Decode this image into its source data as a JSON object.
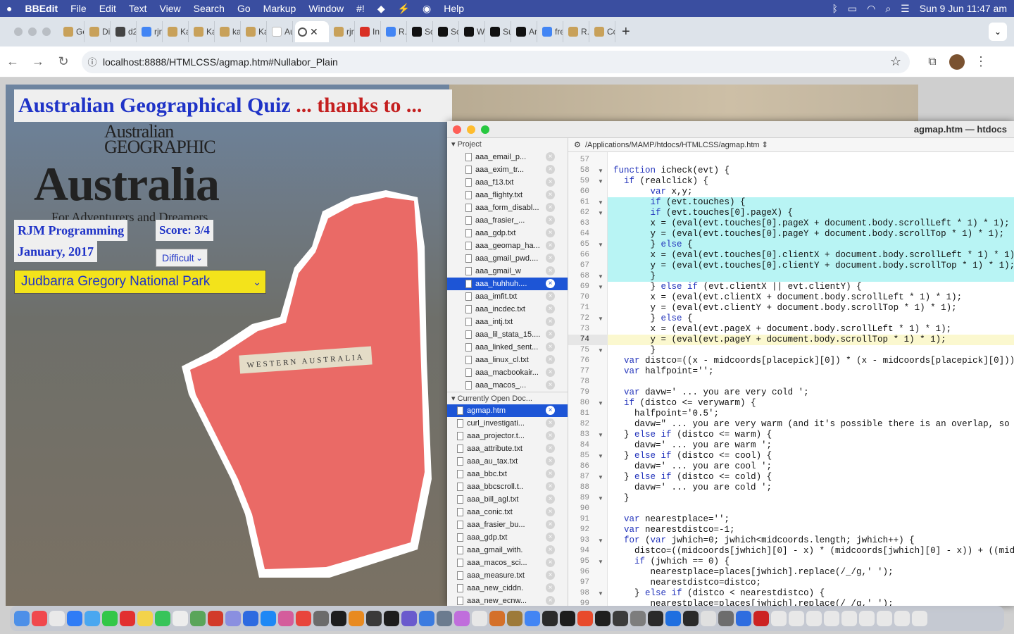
{
  "menubar": {
    "apple": "",
    "app_name": "BBEdit",
    "items": [
      "File",
      "Edit",
      "Text",
      "View",
      "Search",
      "Go",
      "Markup",
      "Window",
      "#!",
      "Help"
    ],
    "clock": "Sun 9 Jun  11:47 am"
  },
  "tabs": [
    {
      "label": "Ge",
      "icon": "#c8a15a"
    },
    {
      "label": "Di",
      "icon": "#c8a15a"
    },
    {
      "label": "d2",
      "icon": "#444444"
    },
    {
      "label": "rjn",
      "icon": "#4285f4"
    },
    {
      "label": "Ka",
      "icon": "#c8a15a"
    },
    {
      "label": "Ka",
      "icon": "#c8a15a"
    },
    {
      "label": "ka",
      "icon": "#c8a15a"
    },
    {
      "label": "Ka",
      "icon": "#c8a15a"
    },
    {
      "label": "Au",
      "icon": "#ffffff"
    },
    {
      "label": "rjn",
      "icon": "#c8a15a"
    },
    {
      "label": "In",
      "icon": "#d93025"
    },
    {
      "label": "R.",
      "icon": "#4285f4"
    },
    {
      "label": "Sc",
      "icon": "#111111"
    },
    {
      "label": "Sc",
      "icon": "#111111"
    },
    {
      "label": "W",
      "icon": "#111111"
    },
    {
      "label": "Su",
      "icon": "#111111"
    },
    {
      "label": "Ar",
      "icon": "#111111"
    },
    {
      "label": "fre",
      "icon": "#4285f4"
    },
    {
      "label": "R.",
      "icon": "#c8a15a"
    },
    {
      "label": "Cc",
      "icon": "#c8a15a"
    }
  ],
  "active_tab_close": "✕",
  "new_tab": "+",
  "address_bar": {
    "url": "localhost:8888/HTMLCSS/agmap.htm#Nullabor_Plain"
  },
  "quiz": {
    "title_main": "Australian Geographical Quiz",
    "title_thanks": " ... thanks to ...",
    "author": "RJM Programming",
    "date": "January, 2017",
    "score": "Score: 3/4",
    "difficulty": "Difficult",
    "selected_place": "Judbarra Gregory National Park",
    "region_label": "WESTERN AUSTRALIA",
    "cover_brand": "Australian GEOGRAPHIC",
    "cover_title": "Australia",
    "cover_tagline": "For Adventurers and Dreamers",
    "region_color": "#ea6a66"
  },
  "bbedit": {
    "window_title": "agmap.htm — htdocs",
    "path": "/Applications/MAMP/htdocs/HTMLCSS/agmap.htm",
    "project_header": "Project",
    "project_files": [
      "aaa_email_p...",
      "aaa_exim_tr...",
      "aaa_f13.txt",
      "aaa_flighty.txt",
      "aaa_form_disabl...",
      "aaa_frasier_...",
      "aaa_gdp.txt",
      "aaa_geomap_ha...",
      "aaa_gmail_pwd....",
      "aaa_gmail_w",
      "aaa_huhhuh....",
      "aaa_imfit.txt",
      "aaa_incdec.txt",
      "aaa_intj.txt",
      "aaa_lil_stata_15....",
      "aaa_linked_sent...",
      "aaa_linux_cl.txt",
      "aaa_macbookair...",
      "aaa_macos_..."
    ],
    "open_header": "Currently Open Doc...",
    "open_files": [
      "agmap.htm",
      "curl_investigati...",
      "aaa_projector.t...",
      "aaa_attribute.txt",
      "aaa_au_tax.txt",
      "aaa_bbc.txt",
      "aaa_bbcscroll.t..",
      "aaa_bill_agl.txt",
      "aaa_conic.txt",
      "aaa_frasier_bu...",
      "aaa_gdp.txt",
      "aaa_gmail_with.",
      "aaa_macos_sci...",
      "aaa_measure.txt",
      "aaa_new_ciddn.",
      "aaa_new_ecnw..."
    ],
    "current_line": "74",
    "code": [
      {
        "n": "57",
        "t": ""
      },
      {
        "n": "58",
        "t": "function icheck(evt) {"
      },
      {
        "n": "59",
        "t": "  if (realclick) {"
      },
      {
        "n": "60",
        "t": "       var x,y;"
      },
      {
        "n": "61",
        "t": "       if (evt.touches) {"
      },
      {
        "n": "62",
        "t": "       if (evt.touches[0].pageX) {"
      },
      {
        "n": "63",
        "t": "       x = (eval(evt.touches[0].pageX + document.body.scrollLeft * 1) * 1);"
      },
      {
        "n": "64",
        "t": "       y = (eval(evt.touches[0].pageY + document.body.scrollTop * 1) * 1);"
      },
      {
        "n": "65",
        "t": "       } else {"
      },
      {
        "n": "66",
        "t": "       x = (eval(evt.touches[0].clientX + document.body.scrollLeft * 1) * 1);"
      },
      {
        "n": "67",
        "t": "       y = (eval(evt.touches[0].clientY + document.body.scrollTop * 1) * 1);"
      },
      {
        "n": "68",
        "t": "       }"
      },
      {
        "n": "69",
        "t": "       } else if (evt.clientX || evt.clientY) {"
      },
      {
        "n": "70",
        "t": "       x = (eval(evt.clientX + document.body.scrollLeft * 1) * 1);"
      },
      {
        "n": "71",
        "t": "       y = (eval(evt.clientY + document.body.scrollTop * 1) * 1);"
      },
      {
        "n": "72",
        "t": "       } else {"
      },
      {
        "n": "73",
        "t": "       x = (eval(evt.pageX + document.body.scrollLeft * 1) * 1);"
      },
      {
        "n": "74",
        "t": "       y = (eval(evt.pageY + document.body.scrollTop * 1) * 1);"
      },
      {
        "n": "75",
        "t": "       }"
      },
      {
        "n": "76",
        "t": "  var distco=((x - midcoords[placepick][0]) * (x - midcoords[placepick][0])) +"
      },
      {
        "n": "77",
        "t": "  var halfpoint='';"
      },
      {
        "n": "78",
        "t": ""
      },
      {
        "n": "79",
        "t": "  var davw=' ... you are very cold ';"
      },
      {
        "n": "80",
        "t": "  if (distco <= verywarm) {"
      },
      {
        "n": "81",
        "t": "    halfpoint='0.5';"
      },
      {
        "n": "82",
        "t": "    davw=\" ... you are very warm (and it's possible there is an overlap, so you"
      },
      {
        "n": "83",
        "t": "  } else if (distco <= warm) {"
      },
      {
        "n": "84",
        "t": "    davw=' ... you are warm ';"
      },
      {
        "n": "85",
        "t": "  } else if (distco <= cool) {"
      },
      {
        "n": "86",
        "t": "    davw=' ... you are cool ';"
      },
      {
        "n": "87",
        "t": "  } else if (distco <= cold) {"
      },
      {
        "n": "88",
        "t": "    davw=' ... you are cold ';"
      },
      {
        "n": "89",
        "t": "  }"
      },
      {
        "n": "90",
        "t": ""
      },
      {
        "n": "91",
        "t": "  var nearestplace='';"
      },
      {
        "n": "92",
        "t": "  var nearestdistco=-1;"
      },
      {
        "n": "93",
        "t": "  for (var jwhich=0; jwhich<midcoords.length; jwhich++) {"
      },
      {
        "n": "94",
        "t": "    distco=((midcoords[jwhich][0] - x) * (midcoords[jwhich][0] - x)) + ((midcoo"
      },
      {
        "n": "95",
        "t": "    if (jwhich == 0) {"
      },
      {
        "n": "96",
        "t": "       nearestplace=places[jwhich].replace(/_/g,' ');"
      },
      {
        "n": "97",
        "t": "       nearestdistco=distco;"
      },
      {
        "n": "98",
        "t": "    } else if (distco < nearestdistco) {"
      },
      {
        "n": "99",
        "t": "       nearestplace=places[jwhich].replace(/_/g,' ');"
      }
    ]
  },
  "dock_colors": [
    "#4d8fe8",
    "#f0484e",
    "#e9e9e9",
    "#2f7cf6",
    "#4aa7f0",
    "#33c748",
    "#e23030",
    "#f3d34a",
    "#37c45a",
    "#ededed",
    "#5aa55a",
    "#d23a2a",
    "#8a8fe0",
    "#2d6ae0",
    "#1e88f5",
    "#d45d9c",
    "#e8453c",
    "#6b6b6b",
    "#1d1d1d",
    "#e88a20",
    "#3a3a3a",
    "#1d1d1d",
    "#6a5acd",
    "#3b7be0",
    "#6b7b8f",
    "#c06edc",
    "#e7e7e7",
    "#d4702a",
    "#9d7a3a",
    "#4285f4",
    "#2b2b2b",
    "#1d1d1d",
    "#e84a2c",
    "#1f1f1f",
    "#3b3b3b",
    "#7d7d7d",
    "#2a2a2a",
    "#1f6fe0",
    "#2a2a2a",
    "#e0e0e0",
    "#6d6d6d",
    "#2e6de0",
    "#c22",
    "#e8e8e8",
    "#e8e8e8",
    "#e8e8e8",
    "#e8e8e8",
    "#e8e8e8",
    "#e8e8e8",
    "#e8e8e8",
    "#e8e8e8",
    "#e8e8e8"
  ]
}
